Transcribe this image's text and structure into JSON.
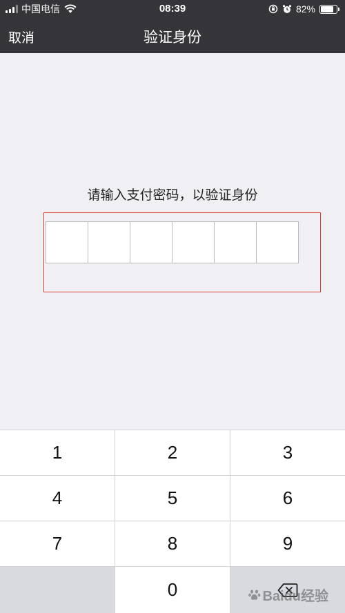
{
  "status_bar": {
    "carrier": "中国电信",
    "time": "08:39",
    "battery_percent": "82%",
    "battery_level": 0.82
  },
  "nav": {
    "cancel_label": "取消",
    "title": "验证身份"
  },
  "prompt": "请输入支付密码，以验证身份",
  "pin_length": 6,
  "colors": {
    "header_bg": "#353539",
    "page_bg": "#efeff4",
    "highlight_border": "#e0393e"
  },
  "keypad": {
    "keys": [
      "1",
      "2",
      "3",
      "4",
      "5",
      "6",
      "7",
      "8",
      "9",
      "",
      "0",
      "delete"
    ]
  },
  "watermark": "Baidu经验"
}
